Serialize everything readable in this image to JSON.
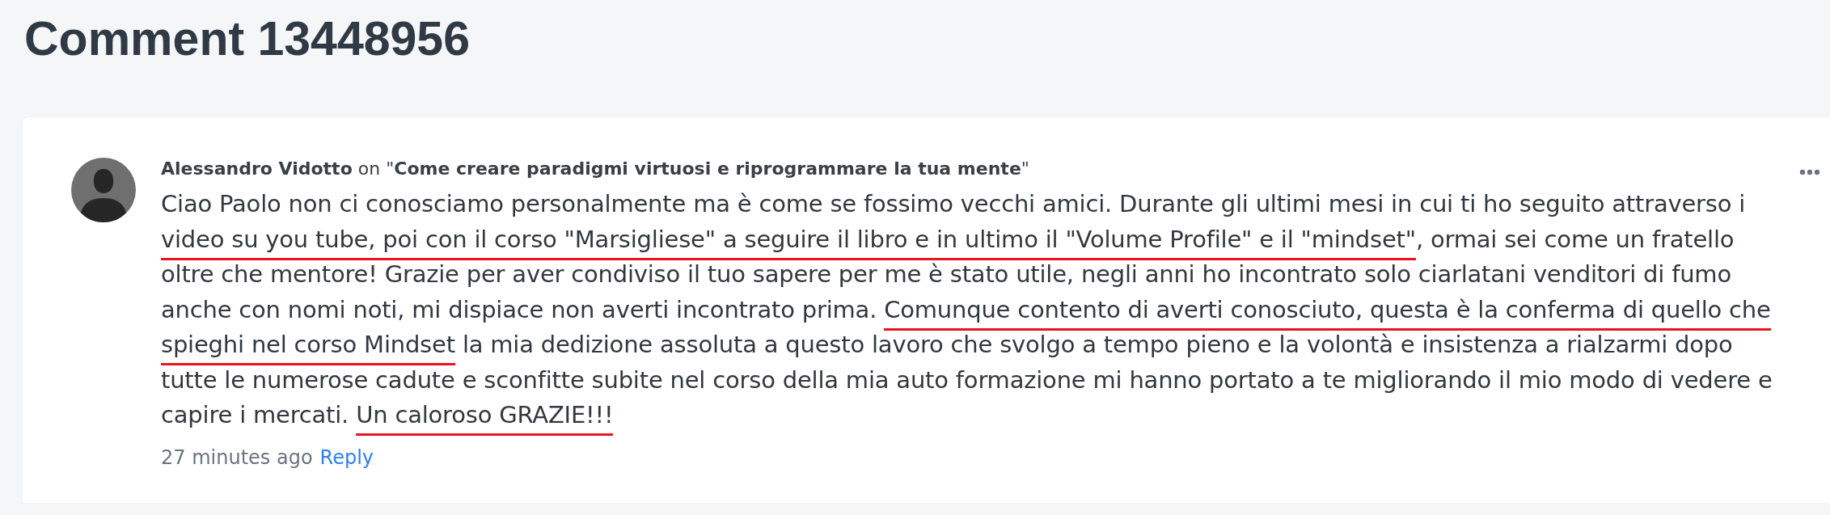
{
  "page_title": "Comment 13448956",
  "comment": {
    "header": "**Alessandro Vidotto** on \"**Come creare paradigmi virtuosi e riprogrammare la tua mente**\"",
    "body": [
      {
        "text": "Ciao Paolo non ci conosciamo personalmente ma è come se fossimo vecchi amici. Durante gli ultimi mesi in cui ti ho seguito attraverso i ",
        "underlined": false
      },
      {
        "text": "video su you tube, poi con il corso \"Marsigliese\" a seguire il libro e in ultimo il \"Volume Profile\" e il \"mindset\"",
        "underlined": true
      },
      {
        "text": ", ormai sei come un fratello oltre che mentore! Grazie per aver condiviso il tuo sapere per me è stato utile, negli anni ho incontrato solo ciarlatani venditori di fumo anche con nomi noti, mi dispiace non averti incontrato prima. ",
        "underlined": false
      },
      {
        "text": "Comunque contento di averti conosciuto, questa è la conferma di quello che spieghi nel corso Mindset",
        "underlined": true
      },
      {
        "text": " la mia dedizione assoluta a questo lavoro che svolgo a tempo pieno e la volontà e insistenza a rialzarmi dopo tutte le numerose cadute e sconfitte subite nel corso della mia auto formazione mi hanno portato a te migliorando il mio modo di vedere e capire i mercati. ",
        "underlined": false
      },
      {
        "text": "Un caloroso GRAZIE!!!",
        "underlined": true
      }
    ],
    "time": "27 minutes ago",
    "reply": "Reply"
  }
}
